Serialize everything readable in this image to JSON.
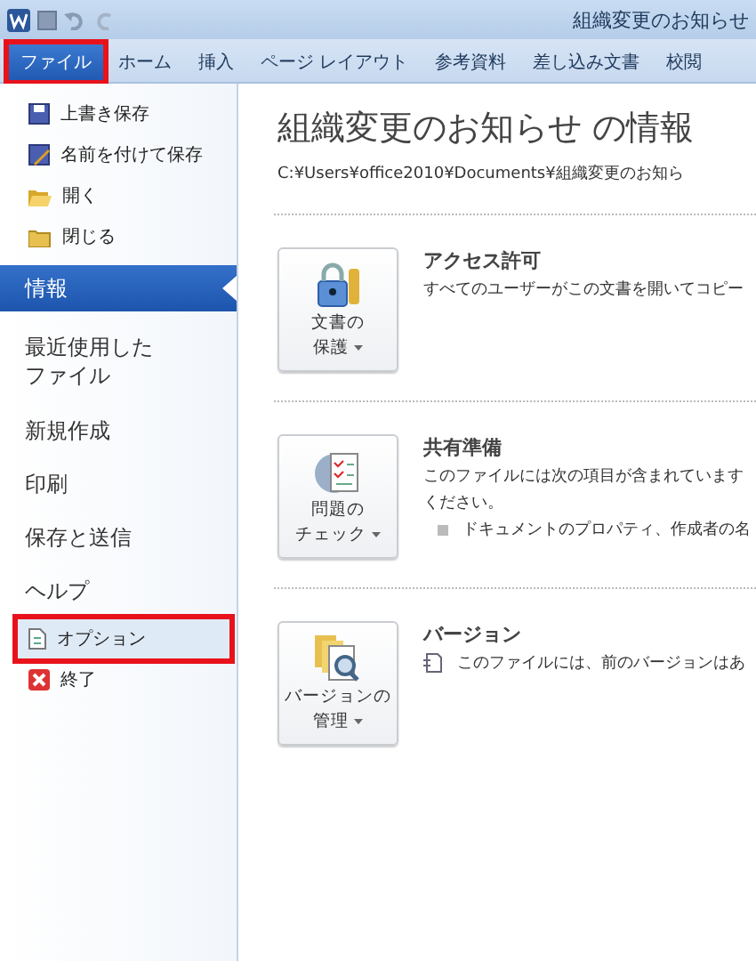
{
  "title_bar": {
    "title": "組織変更のお知らせ"
  },
  "ribbon_tabs": [
    {
      "label": "ファイル",
      "selected": true,
      "highlighted": true
    },
    {
      "label": "ホーム",
      "selected": false,
      "highlighted": false
    },
    {
      "label": "挿入",
      "selected": false,
      "highlighted": false
    },
    {
      "label": "ページ レイアウト",
      "selected": false,
      "highlighted": false
    },
    {
      "label": "参考資料",
      "selected": false,
      "highlighted": false
    },
    {
      "label": "差し込み文書",
      "selected": false,
      "highlighted": false
    },
    {
      "label": "校閲",
      "selected": false,
      "highlighted": false
    }
  ],
  "sidebar": {
    "items": [
      {
        "kind": "command",
        "label": "上書き保存",
        "selected": false,
        "highlighted": false
      },
      {
        "kind": "command",
        "label": "名前を付けて保存",
        "selected": false,
        "highlighted": false
      },
      {
        "kind": "command",
        "label": "開く",
        "selected": false,
        "highlighted": false
      },
      {
        "kind": "command",
        "label": "閉じる",
        "selected": false,
        "highlighted": false
      },
      {
        "kind": "section",
        "label": "情報",
        "selected": true,
        "highlighted": false
      },
      {
        "kind": "section",
        "label": "最近使用したファイル",
        "selected": false,
        "highlighted": false
      },
      {
        "kind": "section",
        "label": "新規作成",
        "selected": false,
        "highlighted": false
      },
      {
        "kind": "section",
        "label": "印刷",
        "selected": false,
        "highlighted": false
      },
      {
        "kind": "section",
        "label": "保存と送信",
        "selected": false,
        "highlighted": false
      },
      {
        "kind": "section",
        "label": "ヘルプ",
        "selected": false,
        "highlighted": false
      },
      {
        "kind": "command",
        "label": "オプション",
        "selected": false,
        "highlighted": true
      },
      {
        "kind": "command",
        "label": "終了",
        "selected": false,
        "highlighted": false
      }
    ]
  },
  "info": {
    "title": "組織変更のお知らせ の情報",
    "path": "C:¥Users¥office2010¥Documents¥組織変更のお知ら",
    "sections": [
      {
        "button": [
          "文書の",
          "保護"
        ],
        "heading": "アクセス許可",
        "lines": [
          {
            "kind": "text",
            "text": "すべてのユーザーがこの文書を開いてコピー"
          }
        ]
      },
      {
        "button": [
          "問題の",
          "チェック"
        ],
        "heading": "共有準備",
        "lines": [
          {
            "kind": "text",
            "text": "このファイルには次の項目が含まれています"
          },
          {
            "kind": "text",
            "text": "ください。"
          },
          {
            "kind": "bullet",
            "text": "ドキュメントのプロパティ、作成者の名"
          }
        ]
      },
      {
        "button": [
          "バージョンの",
          "管理"
        ],
        "heading": "バージョン",
        "lines": [
          {
            "kind": "version",
            "text": "このファイルには、前のバージョンはあ"
          }
        ]
      }
    ]
  }
}
